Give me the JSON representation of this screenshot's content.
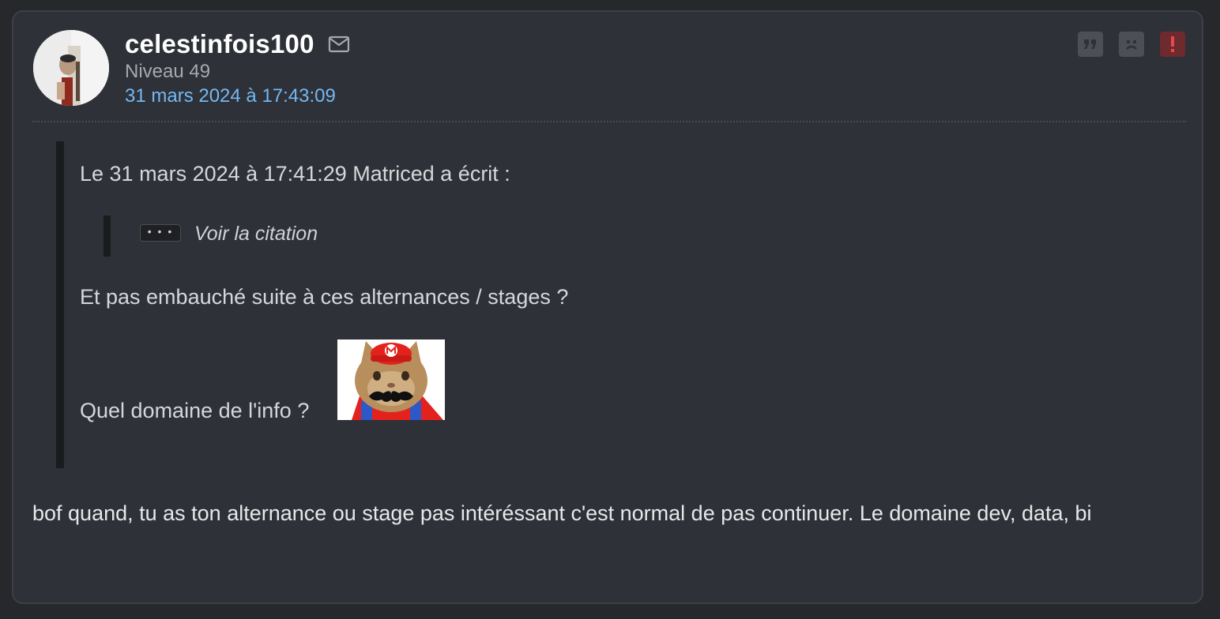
{
  "post": {
    "author": "celestinfois100",
    "level": "Niveau 49",
    "date": "31 mars 2024 à 17:43:09",
    "icons": {
      "mail": "envelope-icon",
      "quote": "quote-icon",
      "sad": "sad-face-icon",
      "report": "exclamation-icon"
    },
    "colors": {
      "date_link": "#75b8f0",
      "report": "#6e2a2c",
      "card_bg": "#2e3138"
    },
    "quote": {
      "header": "Le 31 mars 2024 à 17:41:29 Matriced a écrit :",
      "expand_label": "• • •",
      "nested_label": "Voir la citation",
      "line1": "Et pas embauché suite à ces alternances / stages ?",
      "line2": "Quel domaine de l'info ?"
    },
    "body": "bof quand, tu as ton alternance ou stage pas intéréssant c'est normal de pas continuer. Le domaine dev, data, bi"
  }
}
